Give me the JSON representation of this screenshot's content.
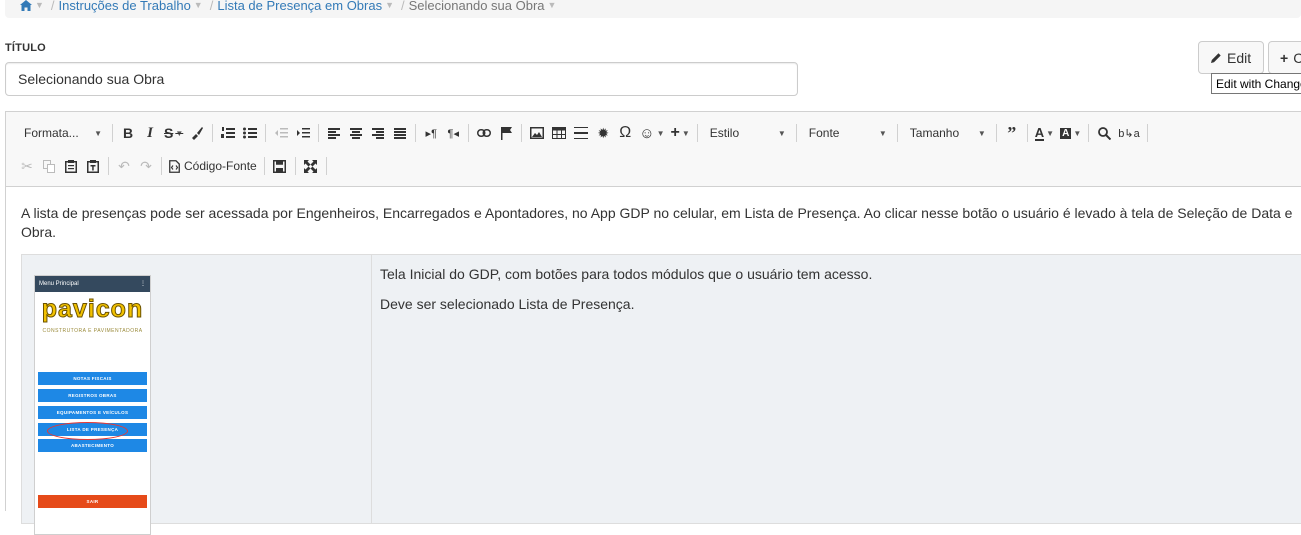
{
  "breadcrumb": {
    "items": [
      "Instruções de Trabalho",
      "Lista de Presença em Obras"
    ],
    "current": "Selecionando sua Obra"
  },
  "form": {
    "title_label": "TÍTULO",
    "title_value": "Selecionando sua Obra"
  },
  "actions": {
    "edit_label": "Edit",
    "add_label": "C",
    "tooltip": "Edit with Change"
  },
  "toolbar": {
    "format_combo": "Formata...",
    "style_combo": "Estilo",
    "font_combo": "Fonte",
    "size_combo": "Tamanho",
    "source_label": "Código-Fonte",
    "icons": [
      "bold-icon",
      "italic-icon",
      "strikethrough-icon",
      "format-painter-icon",
      "ordered-list-icon",
      "bullet-list-icon",
      "outdent-icon",
      "indent-icon",
      "align-left-icon",
      "align-center-icon",
      "align-right-icon",
      "align-justify-icon",
      "ltr-icon",
      "rtl-icon",
      "link-icon",
      "anchor-flag-icon",
      "image-icon",
      "table-icon",
      "horizontal-rule-icon",
      "settings-icon",
      "special-char-icon",
      "emoji-icon",
      "insert-plus-icon",
      "blockquote-icon",
      "text-color-icon",
      "background-color-icon",
      "search-icon",
      "replace-icon",
      "cut-icon",
      "copy-icon",
      "paste-icon",
      "paste-text-icon",
      "undo-icon",
      "redo-icon",
      "code-icon",
      "save-icon",
      "fullscreen-icon"
    ]
  },
  "content": {
    "intro": "A lista de presenças pode ser acessada por Engenheiros, Encarregados e Apontadores, no App GDP no celular, em Lista de Presença. Ao clicar nesse botão o usuário é levado à tela de Seleção de Data e Obra.",
    "cell_text_1": "Tela Inicial do GDP, com botões para todos módulos que o usuário tem acesso.",
    "cell_text_2": "Deve ser selecionado Lista de Presença."
  },
  "phone": {
    "bar_title": "Menu Principal",
    "bar_menu": "⋮",
    "logo_word": "pavicon",
    "logo_sub": "CONSTRUTORA E PAVIMENTADORA",
    "buttons": [
      "NOTAS FISCAIS",
      "REGISTROS OBRAS",
      "EQUIPAMENTOS E VEÍCULOS",
      "LISTA DE PRESENÇA",
      "ABASTECIMENTO"
    ],
    "bottom_button": "SAIR"
  },
  "colors": {
    "link": "#337ab7",
    "phone_bar": "#34495e",
    "phone_button": "#1e88e5",
    "highlight": "#e53935",
    "logo": "#f2c200"
  }
}
